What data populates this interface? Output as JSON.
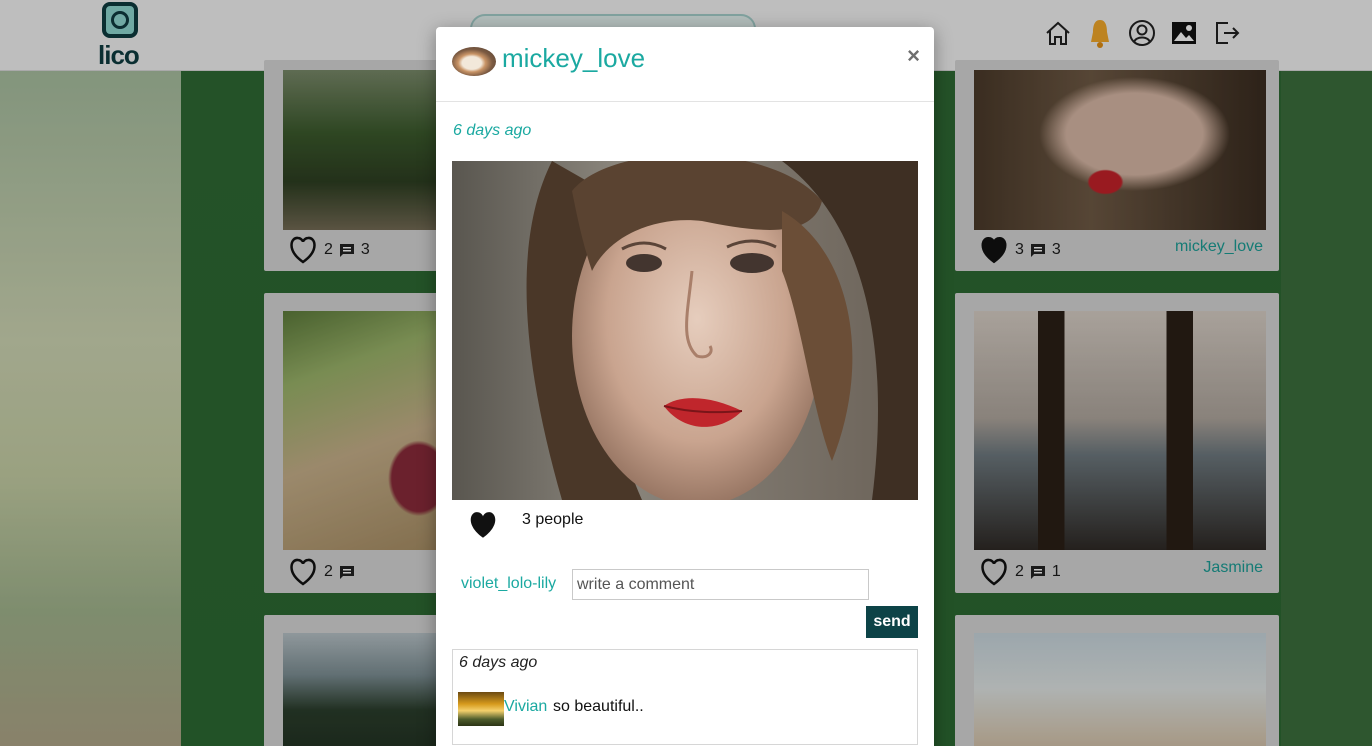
{
  "app": {
    "logo_text": "lico"
  },
  "nav": {
    "icons": [
      "home-icon",
      "bell-icon",
      "profile-icon",
      "gallery-icon",
      "logout-icon"
    ]
  },
  "cards": [
    {
      "likes": "2",
      "comments": "3",
      "author": "",
      "liked": false
    },
    {
      "likes": "3",
      "comments": "3",
      "author": "mickey_love",
      "liked": true
    },
    {
      "likes": "2",
      "comments": "",
      "author": "",
      "liked": false
    },
    {
      "likes": "2",
      "comments": "1",
      "author": "Jasmine",
      "liked": false
    }
  ],
  "modal": {
    "username": "mickey_love",
    "close_label": "×",
    "posted_time": "6 days ago",
    "likes_label": "3 people",
    "current_user": "violet_lolo-lily",
    "comment_placeholder": "write a comment",
    "send_label": "send",
    "comments": [
      {
        "time": "6 days ago",
        "user": "Vivian",
        "text": "so beautiful.."
      }
    ]
  },
  "colors": {
    "accent": "#1ba9a1",
    "dark": "#0d4347",
    "background": "#3a6b3e"
  }
}
